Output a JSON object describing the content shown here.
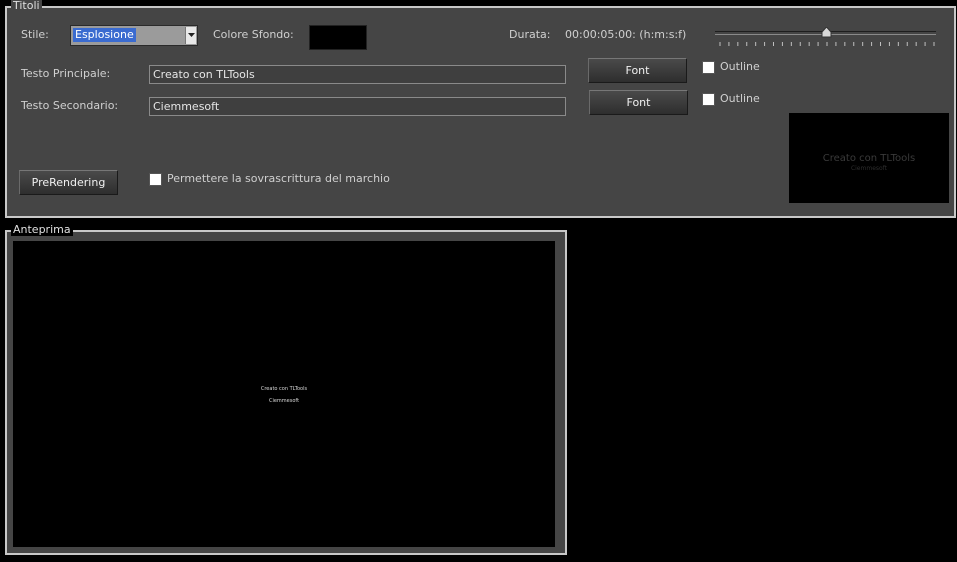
{
  "titoli": {
    "legend": "Titoli",
    "stile_label": "Stile:",
    "stile_value": "Esplosione",
    "colore_sfondo_label": "Colore Sfondo:",
    "colore_sfondo_value": "#000000",
    "durata_label": "Durata:",
    "durata_value": "00:00:05:00: (h:m:s:f)",
    "durata_slider_fraction": 0.5,
    "testo_principale_label": "Testo Principale:",
    "testo_principale_value": "Creato con TLTools",
    "testo_secondario_label": "Testo Secondario:",
    "testo_secondario_value": "Ciemmesoft",
    "font_button_1": "Font",
    "font_button_2": "Font",
    "outline_label_1": "Outline",
    "outline_label_2": "Outline",
    "outline_checked_1": false,
    "outline_checked_2": false,
    "prerendering_button": "PreRendering",
    "permettere_label": "Permettere la sovrascrittura del marchio",
    "permettere_checked": false
  },
  "anteprima": {
    "legend": "Anteprima"
  }
}
